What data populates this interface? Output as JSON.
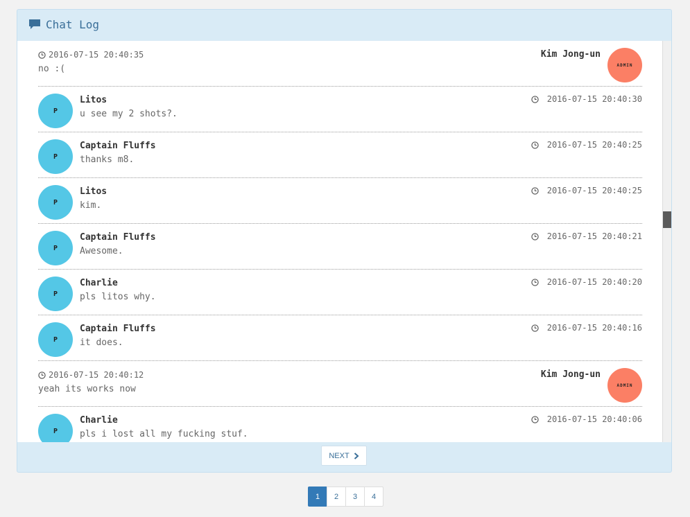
{
  "panel": {
    "title": "Chat Log",
    "icon": "chat-bubble-icon"
  },
  "messages": [
    {
      "type": "admin",
      "name": "Kim Jong-un",
      "time": "2016-07-15 20:40:35",
      "text": "no :(",
      "avatar": "ADMIN"
    },
    {
      "type": "user",
      "name": "Litos",
      "time": "2016-07-15 20:40:30",
      "text": "u see my 2 shots?.",
      "avatar": "P"
    },
    {
      "type": "user",
      "name": "Captain Fluffs",
      "time": "2016-07-15 20:40:25",
      "text": "thanks m8.",
      "avatar": "P"
    },
    {
      "type": "user",
      "name": "Litos",
      "time": "2016-07-15 20:40:25",
      "text": "kim.",
      "avatar": "P"
    },
    {
      "type": "user",
      "name": "Captain Fluffs",
      "time": "2016-07-15 20:40:21",
      "text": "Awesome.",
      "avatar": "P"
    },
    {
      "type": "user",
      "name": "Charlie",
      "time": "2016-07-15 20:40:20",
      "text": "pls litos why.",
      "avatar": "P"
    },
    {
      "type": "user",
      "name": "Captain Fluffs",
      "time": "2016-07-15 20:40:16",
      "text": "it does.",
      "avatar": "P"
    },
    {
      "type": "admin",
      "name": "Kim Jong-un",
      "time": "2016-07-15 20:40:12",
      "text": "yeah its works now",
      "avatar": "ADMIN"
    },
    {
      "type": "user",
      "name": "Charlie",
      "time": "2016-07-15 20:40:06",
      "text": "pls i lost all my fucking stuf.",
      "avatar": "P"
    }
  ],
  "footer": {
    "next_label": "NEXT"
  },
  "pagination": {
    "pages": [
      "1",
      "2",
      "3",
      "4"
    ],
    "current": "1"
  },
  "colors": {
    "user_avatar": "#54c7e6",
    "admin_avatar": "#fb7f65",
    "panel_bg": "#d9ebf6",
    "accent": "#337ab7"
  }
}
